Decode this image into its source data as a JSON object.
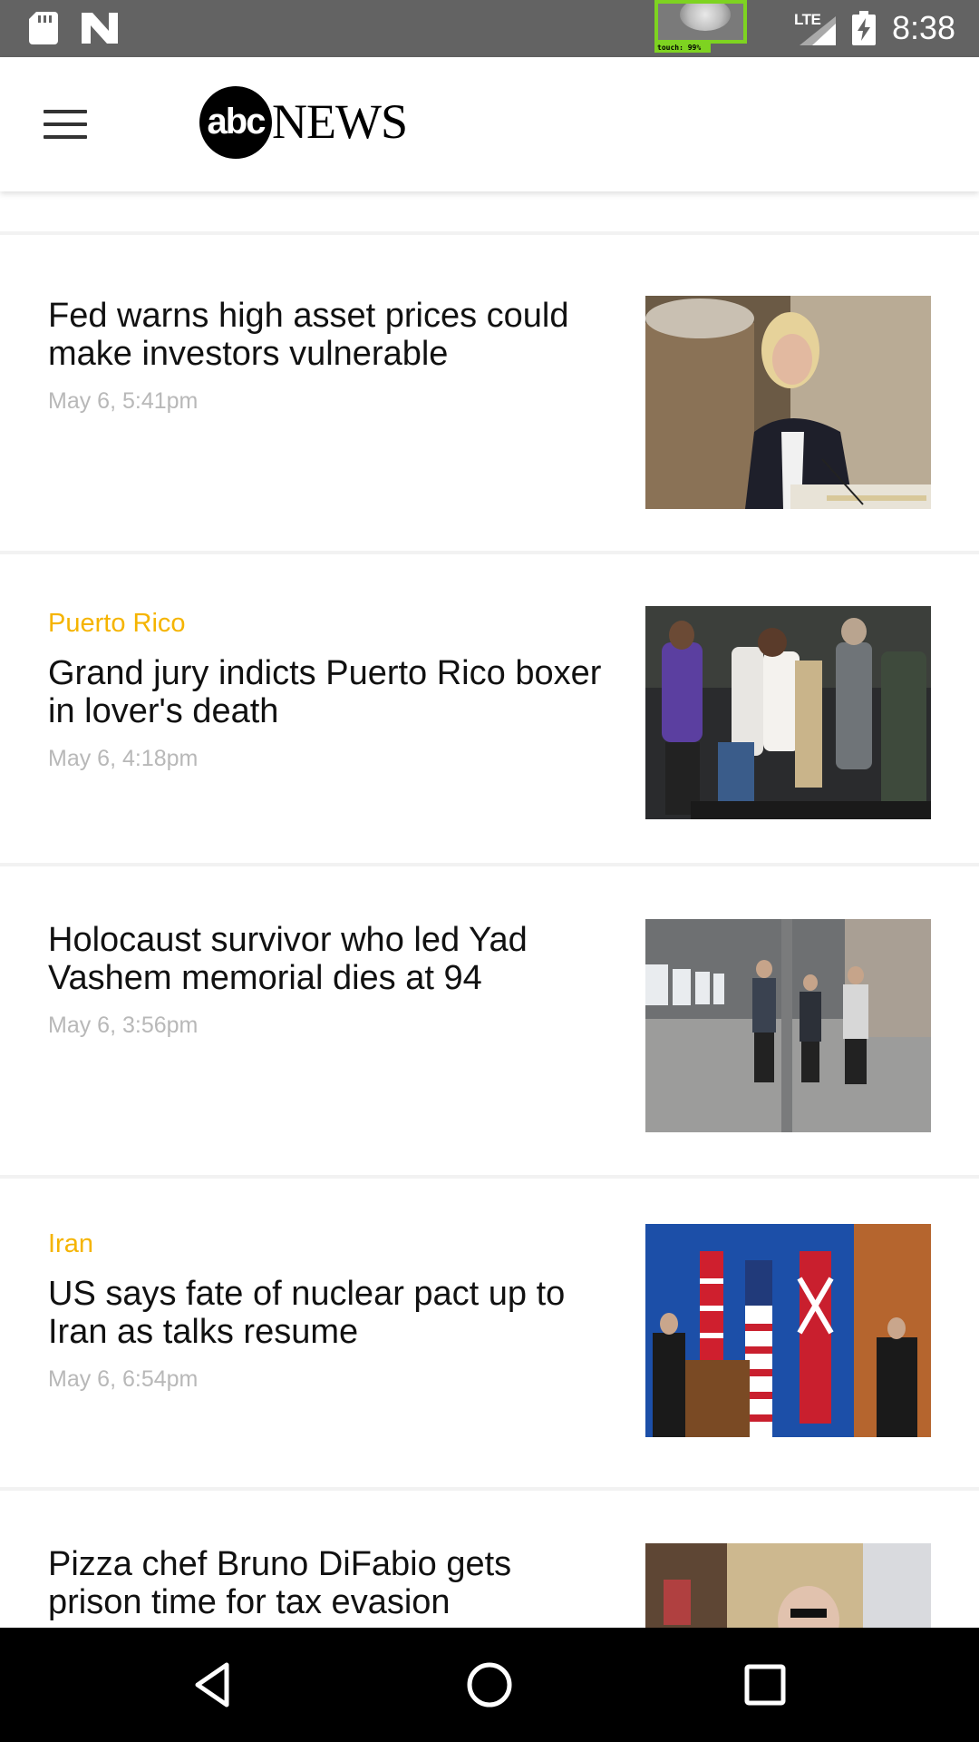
{
  "status_bar": {
    "time": "8:38",
    "network_label": "LTE",
    "touch_label": "touch: 99%",
    "icons": [
      "sd-card-icon",
      "n-logo-icon",
      "signal-icon",
      "battery-charging-icon"
    ]
  },
  "header": {
    "menu_icon": "hamburger-menu-icon",
    "logo_abc": "abc",
    "logo_news": "NEWS"
  },
  "colors": {
    "category_accent": "#f5b400",
    "timestamp": "#b8b8b8",
    "status_bar_bg": "#636363",
    "touch_indicator": "#7ed321"
  },
  "articles": [
    {
      "category": "",
      "headline": "Fed warns high asset prices could make investors vulnerable",
      "timestamp": "May 6, 5:41pm"
    },
    {
      "category": "Puerto Rico",
      "headline": "Grand jury indicts Puerto Rico boxer in lover's death",
      "timestamp": "May 6, 4:18pm"
    },
    {
      "category": "",
      "headline": "Holocaust survivor who led Yad Vashem memorial dies at 94",
      "timestamp": "May 6, 3:56pm"
    },
    {
      "category": "Iran",
      "headline": "US says fate of nuclear pact up to Iran as talks resume",
      "timestamp": "May 6, 6:54pm"
    },
    {
      "category": "",
      "headline": "Pizza chef Bruno DiFabio gets prison time for tax evasion",
      "timestamp": ""
    }
  ],
  "nav_bar": {
    "icons": [
      "back-icon",
      "home-icon",
      "recents-icon"
    ]
  }
}
